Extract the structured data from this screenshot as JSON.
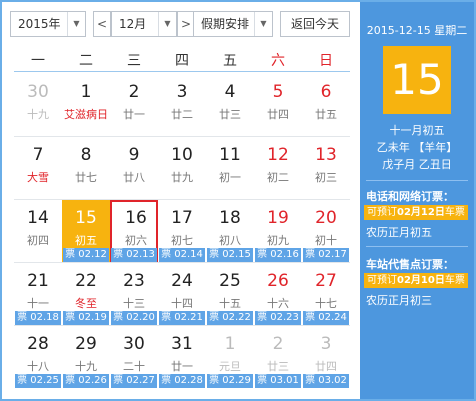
{
  "toolbar": {
    "year": "2015年",
    "prev": "<",
    "month": "12月",
    "next": ">",
    "holiday": "假期安排",
    "today": "返回今天"
  },
  "weekdays": [
    "一",
    "二",
    "三",
    "四",
    "五",
    "六",
    "日"
  ],
  "weeks": [
    [
      {
        "d": "30",
        "l": "十九"
      },
      {
        "d": "1",
        "l": "艾滋病日"
      },
      {
        "d": "2",
        "l": "廿一"
      },
      {
        "d": "3",
        "l": "廿二"
      },
      {
        "d": "4",
        "l": "廿三"
      },
      {
        "d": "5",
        "l": "廿四"
      },
      {
        "d": "6",
        "l": "廿五"
      }
    ],
    [
      {
        "d": "7",
        "l": "大雪"
      },
      {
        "d": "8",
        "l": "廿七"
      },
      {
        "d": "9",
        "l": "廿八"
      },
      {
        "d": "10",
        "l": "廿九"
      },
      {
        "d": "11",
        "l": "初一"
      },
      {
        "d": "12",
        "l": "初二"
      },
      {
        "d": "13",
        "l": "初三"
      }
    ],
    [
      {
        "d": "14",
        "l": "初四"
      },
      {
        "d": "15",
        "l": "初五",
        "t": "票 02.12"
      },
      {
        "d": "16",
        "l": "初六",
        "t": "票 02.13"
      },
      {
        "d": "17",
        "l": "初七",
        "t": "票 02.14"
      },
      {
        "d": "18",
        "l": "初八",
        "t": "票 02.15"
      },
      {
        "d": "19",
        "l": "初九",
        "t": "票 02.16"
      },
      {
        "d": "20",
        "l": "初十",
        "t": "票 02.17"
      }
    ],
    [
      {
        "d": "21",
        "l": "十一",
        "t": "票 02.18"
      },
      {
        "d": "22",
        "l": "冬至",
        "t": "票 02.19"
      },
      {
        "d": "23",
        "l": "十三",
        "t": "票 02.20"
      },
      {
        "d": "24",
        "l": "十四",
        "t": "票 02.21"
      },
      {
        "d": "25",
        "l": "十五",
        "t": "票 02.22"
      },
      {
        "d": "26",
        "l": "十六",
        "t": "票 02.23"
      },
      {
        "d": "27",
        "l": "十七",
        "t": "票 02.24"
      }
    ],
    [
      {
        "d": "28",
        "l": "十八",
        "t": "票 02.25"
      },
      {
        "d": "29",
        "l": "十九",
        "t": "票 02.26"
      },
      {
        "d": "30",
        "l": "二十",
        "t": "票 02.27"
      },
      {
        "d": "31",
        "l": "廿一",
        "t": "票 02.28"
      },
      {
        "d": "1",
        "l": "元旦",
        "t": "票 02.29"
      },
      {
        "d": "2",
        "l": "廿三",
        "t": "票 03.01"
      },
      {
        "d": "3",
        "l": "廿四",
        "t": "票 03.02"
      }
    ]
  ],
  "side": {
    "date": "2015-12-15 星期二",
    "day": "15",
    "lunar": "十一月初五",
    "ganzhi_year": "乙未年 【羊年】",
    "ganzhi_md": "戊子月 乙丑日",
    "phone_title": "电话和网络订票：",
    "phone_badge_pre": "可预订",
    "phone_badge_date": "02月12日",
    "phone_badge_post": "车票",
    "phone_lunar": "农历正月初五",
    "agent_title": "车站代售点订票：",
    "agent_badge_pre": "可预订",
    "agent_badge_date": "02月10日",
    "agent_badge_post": "车票",
    "agent_lunar": "农历正月初三"
  },
  "colors": {
    "accent_blue": "#4d97de",
    "today_orange": "#f7b30f",
    "weekend_red": "#e0242a",
    "ticket_blue": "#5fa4e6"
  }
}
